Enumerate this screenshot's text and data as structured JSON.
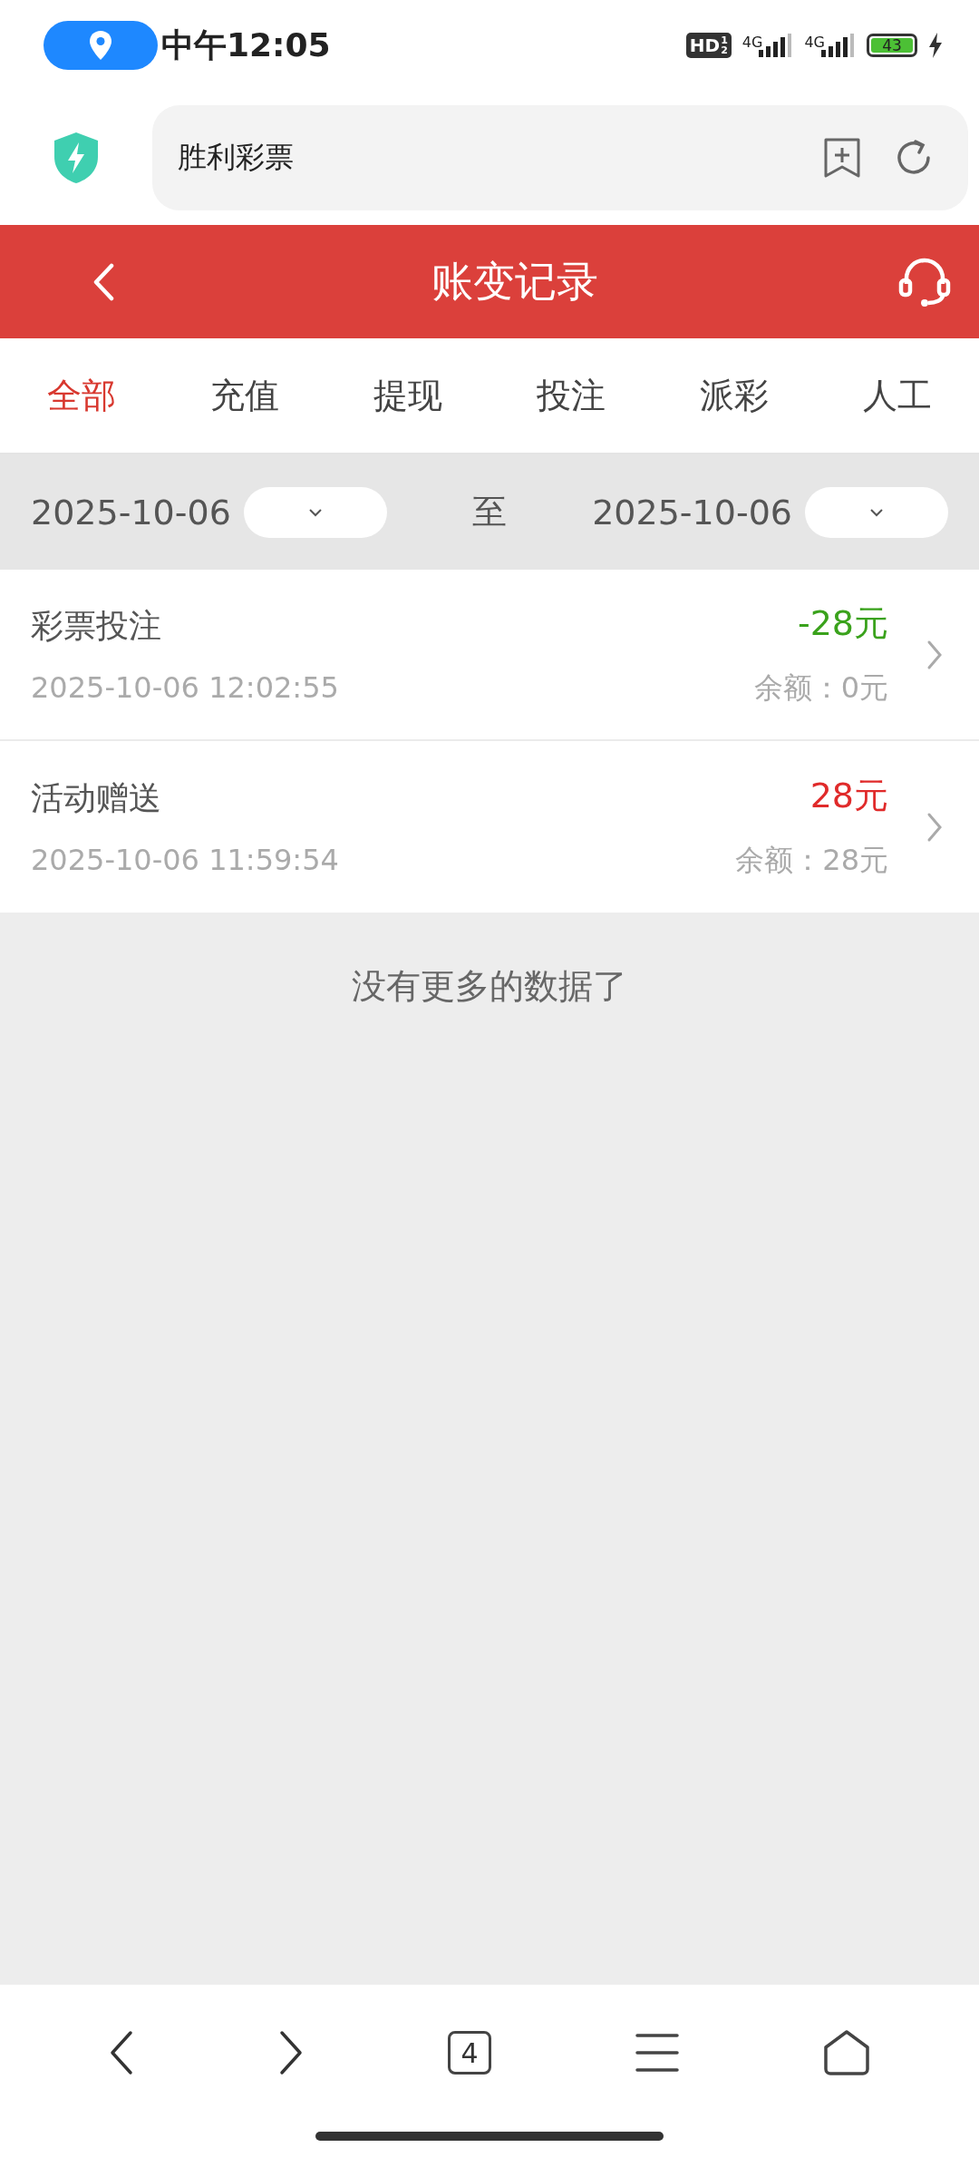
{
  "status_bar": {
    "time": "中午12:05",
    "hd_badge": "HD",
    "hd_sub": "1",
    "hd_sub2": "2",
    "network_1": "4G",
    "network_2": "4G",
    "battery": "43"
  },
  "address_bar": {
    "title": "胜利彩票"
  },
  "header": {
    "title": "账变记录"
  },
  "tabs": [
    {
      "label": "全部",
      "selected": true
    },
    {
      "label": "充值",
      "selected": false
    },
    {
      "label": "提现",
      "selected": false
    },
    {
      "label": "投注",
      "selected": false
    },
    {
      "label": "派彩",
      "selected": false
    },
    {
      "label": "人工",
      "selected": false
    }
  ],
  "date_filter": {
    "start": "2025-10-06",
    "separator": "至",
    "end": "2025-10-06"
  },
  "records": [
    {
      "title": "彩票投注",
      "time": "2025-10-06 12:02:55",
      "amount": "-28元",
      "kind": "expense",
      "balance": "余额：0元"
    },
    {
      "title": "活动赠送",
      "time": "2025-10-06 11:59:54",
      "amount": "28元",
      "kind": "income",
      "balance": "余额：28元"
    }
  ],
  "end_message": "没有更多的数据了",
  "bottom_nav": {
    "tab_count": "4"
  }
}
